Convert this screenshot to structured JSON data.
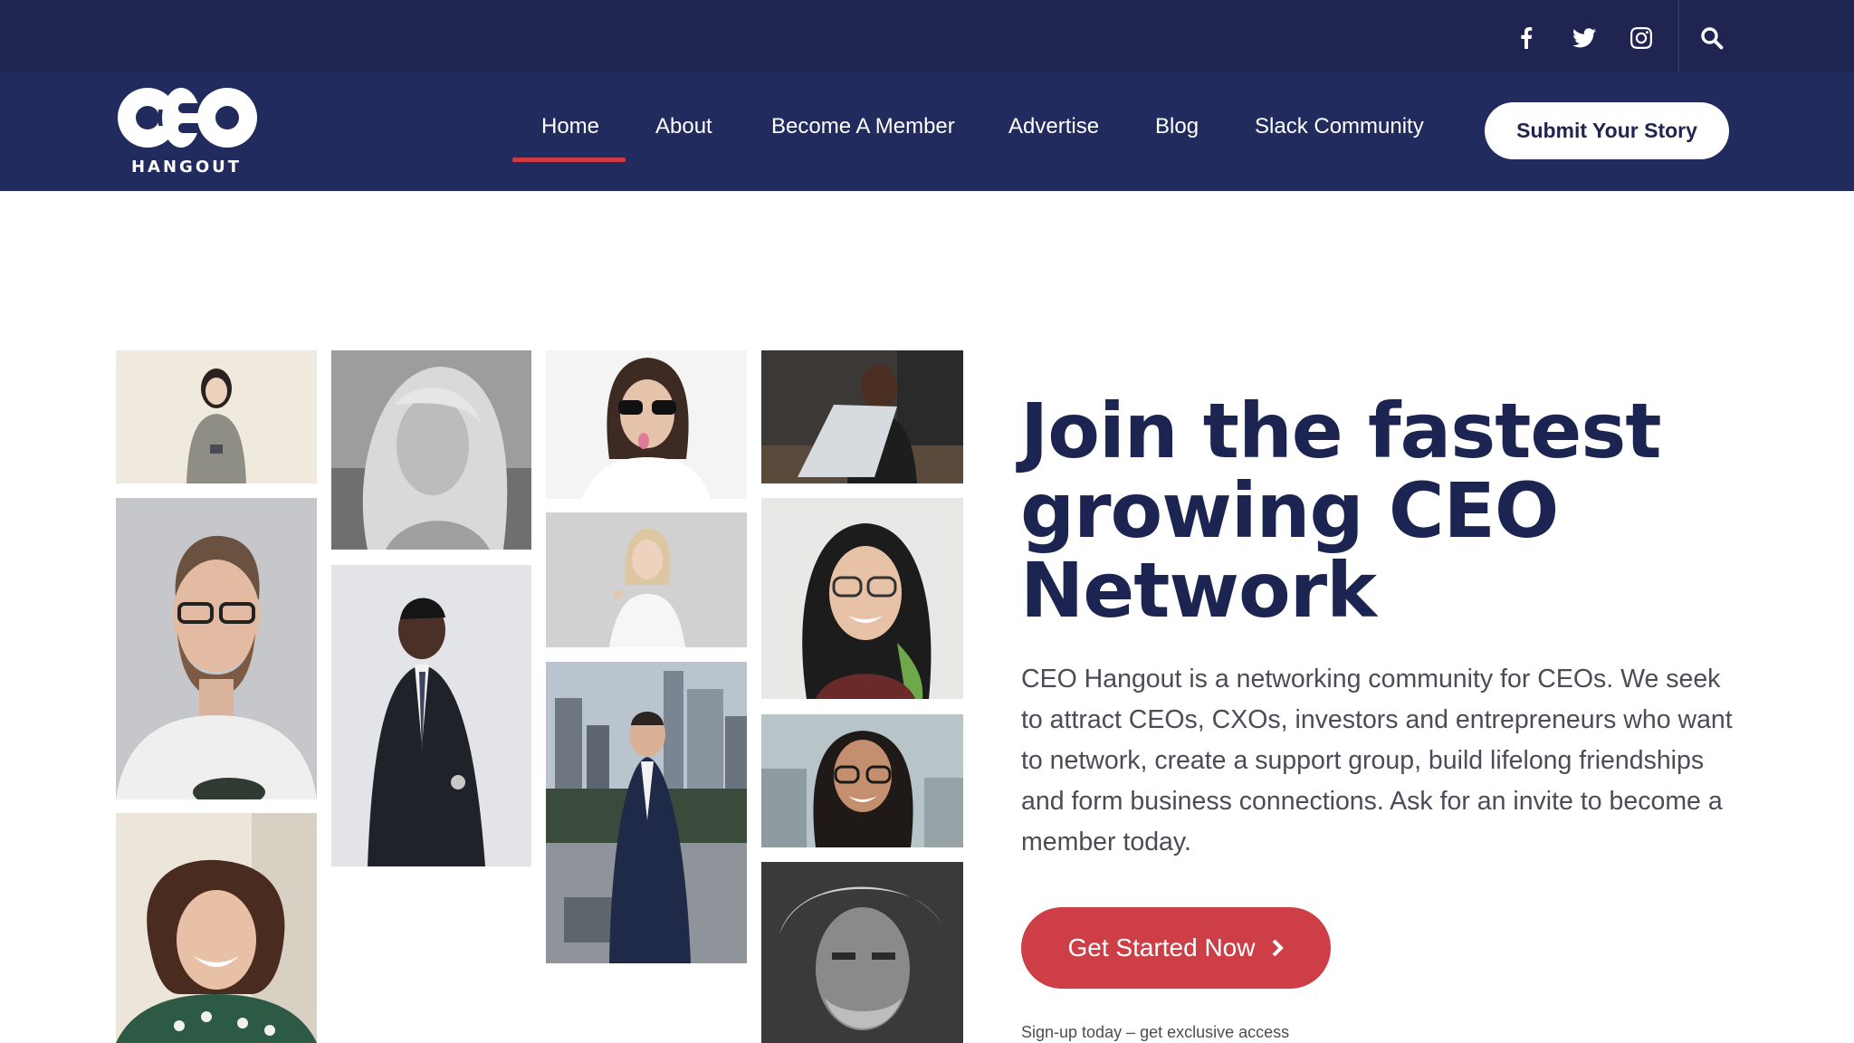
{
  "topbar": {
    "social_icons": [
      "facebook-icon",
      "twitter-icon",
      "instagram-icon"
    ],
    "search_icon": "search-icon"
  },
  "logo": {
    "mark": "CEO",
    "subtitle": "HANGOUT"
  },
  "nav": {
    "items": [
      {
        "label": "Home",
        "active": true
      },
      {
        "label": "About"
      },
      {
        "label": "Become A Member"
      },
      {
        "label": "Advertise"
      },
      {
        "label": "Blog"
      },
      {
        "label": "Slack Community"
      }
    ],
    "cta_label": "Submit Your Story"
  },
  "hero": {
    "title": "Join the fastest growing CEO Network",
    "body": "CEO Hangout is a networking community for CEOs. We seek to attract CEOs, CXOs, investors and entrepreneurs who want to network, create a support group, build lifelong friendships and form business connections. Ask for an invite to become a member today.",
    "cta_label": "Get Started Now",
    "cta_icon": "chevron-right-icon",
    "fineprint": "Sign-up today – get exclusive access"
  },
  "colors": {
    "topbar": "#1f2550",
    "navbar": "#222b5e",
    "accent_red": "#ce3e46",
    "heading": "#1c2451",
    "body_text": "#4a4d57"
  }
}
